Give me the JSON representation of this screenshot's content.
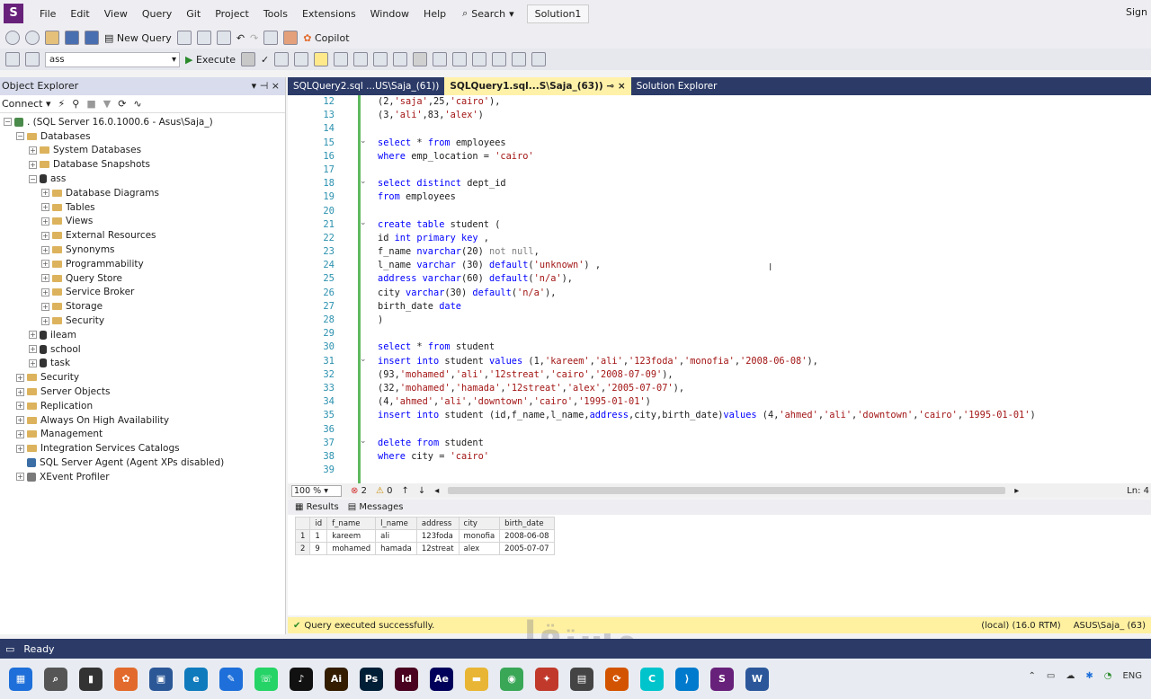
{
  "menu": {
    "items": [
      "File",
      "Edit",
      "View",
      "Query",
      "Git",
      "Project",
      "Tools",
      "Extensions",
      "Window",
      "Help"
    ],
    "search": "Search",
    "solution": "Solution1",
    "sign": "Sign"
  },
  "toolbar1": {
    "new_query": "New Query",
    "copilot": "Copilot"
  },
  "toolbar2": {
    "database": "ass",
    "execute": "Execute"
  },
  "object_explorer": {
    "title": "Object Explorer",
    "connect": "Connect",
    "nodes": [
      {
        "label": ". (SQL Server 16.0.1000.6 - Asus\\Saja_)",
        "level": 0,
        "kind": "server",
        "exp": "-"
      },
      {
        "label": "Databases",
        "level": 1,
        "kind": "folder",
        "exp": "-"
      },
      {
        "label": "System Databases",
        "level": 2,
        "kind": "folder",
        "exp": "+"
      },
      {
        "label": "Database Snapshots",
        "level": 2,
        "kind": "folder",
        "exp": "+"
      },
      {
        "label": "ass",
        "level": 2,
        "kind": "db",
        "exp": "-"
      },
      {
        "label": "Database Diagrams",
        "level": 3,
        "kind": "folder",
        "exp": "+"
      },
      {
        "label": "Tables",
        "level": 3,
        "kind": "folder",
        "exp": "+"
      },
      {
        "label": "Views",
        "level": 3,
        "kind": "folder",
        "exp": "+"
      },
      {
        "label": "External Resources",
        "level": 3,
        "kind": "folder",
        "exp": "+"
      },
      {
        "label": "Synonyms",
        "level": 3,
        "kind": "folder",
        "exp": "+"
      },
      {
        "label": "Programmability",
        "level": 3,
        "kind": "folder",
        "exp": "+"
      },
      {
        "label": "Query Store",
        "level": 3,
        "kind": "folder",
        "exp": "+"
      },
      {
        "label": "Service Broker",
        "level": 3,
        "kind": "folder",
        "exp": "+"
      },
      {
        "label": "Storage",
        "level": 3,
        "kind": "folder",
        "exp": "+"
      },
      {
        "label": "Security",
        "level": 3,
        "kind": "folder",
        "exp": "+"
      },
      {
        "label": "ileam",
        "level": 2,
        "kind": "db",
        "exp": "+"
      },
      {
        "label": "school",
        "level": 2,
        "kind": "db",
        "exp": "+"
      },
      {
        "label": "task",
        "level": 2,
        "kind": "db",
        "exp": "+"
      },
      {
        "label": "Security",
        "level": 1,
        "kind": "folder",
        "exp": "+"
      },
      {
        "label": "Server Objects",
        "level": 1,
        "kind": "folder",
        "exp": "+"
      },
      {
        "label": "Replication",
        "level": 1,
        "kind": "folder",
        "exp": "+"
      },
      {
        "label": "Always On High Availability",
        "level": 1,
        "kind": "folder",
        "exp": "+"
      },
      {
        "label": "Management",
        "level": 1,
        "kind": "folder",
        "exp": "+"
      },
      {
        "label": "Integration Services Catalogs",
        "level": 1,
        "kind": "folder",
        "exp": "+"
      },
      {
        "label": "SQL Server Agent (Agent XPs disabled)",
        "level": 1,
        "kind": "agent",
        "exp": ""
      },
      {
        "label": "XEvent Profiler",
        "level": 1,
        "kind": "xevent",
        "exp": "+"
      }
    ]
  },
  "tabs": [
    {
      "label": "SQLQuery2.sql ...US\\Saja_(61))",
      "active": false
    },
    {
      "label": "SQLQuery1.sql...S\\Saja_(63))",
      "active": true
    },
    {
      "label": "Solution Explorer",
      "active": false
    }
  ],
  "editor": {
    "lines": [
      {
        "n": "12",
        "fold": false,
        "tokens": [
          [
            "",
            "("
          ],
          [
            "num",
            "2"
          ],
          [
            "",
            ","
          ],
          [
            "str",
            "'saja'"
          ],
          [
            "",
            ",25,"
          ],
          [
            "str",
            "'cairo'"
          ],
          [
            "",
            "),"
          ]
        ]
      },
      {
        "n": "13",
        "fold": false,
        "tokens": [
          [
            "",
            "(3,"
          ],
          [
            "str",
            "'ali'"
          ],
          [
            "",
            ",83,"
          ],
          [
            "str",
            "'alex'"
          ],
          [
            "",
            ")"
          ]
        ]
      },
      {
        "n": "14",
        "fold": false,
        "tokens": []
      },
      {
        "n": "15",
        "fold": true,
        "tokens": [
          [
            "kw",
            "select"
          ],
          [
            "",
            " * "
          ],
          [
            "kw",
            "from"
          ],
          [
            "",
            " employees"
          ]
        ]
      },
      {
        "n": "16",
        "fold": false,
        "tokens": [
          [
            "kw",
            "where"
          ],
          [
            "",
            " emp_location = "
          ],
          [
            "str",
            "'cairo'"
          ]
        ]
      },
      {
        "n": "17",
        "fold": false,
        "tokens": []
      },
      {
        "n": "18",
        "fold": true,
        "tokens": [
          [
            "kw",
            "select distinct"
          ],
          [
            "",
            " dept_id"
          ]
        ]
      },
      {
        "n": "19",
        "fold": false,
        "tokens": [
          [
            "kw",
            "from"
          ],
          [
            "",
            " employees"
          ]
        ]
      },
      {
        "n": "20",
        "fold": false,
        "tokens": []
      },
      {
        "n": "21",
        "fold": true,
        "tokens": [
          [
            "kw",
            "create table"
          ],
          [
            "",
            " student ("
          ]
        ]
      },
      {
        "n": "22",
        "fold": false,
        "tokens": [
          [
            "",
            "id "
          ],
          [
            "kw",
            "int primary key"
          ],
          [
            "",
            " ,"
          ]
        ]
      },
      {
        "n": "23",
        "fold": false,
        "tokens": [
          [
            "",
            "f_name "
          ],
          [
            "kw",
            "nvarchar"
          ],
          [
            "",
            "(20) "
          ],
          [
            "gr",
            "not null"
          ],
          [
            "",
            ","
          ]
        ]
      },
      {
        "n": "24",
        "fold": false,
        "tokens": [
          [
            "",
            "l_name "
          ],
          [
            "kw",
            "varchar"
          ],
          [
            "",
            " (30) "
          ],
          [
            "kw",
            "default"
          ],
          [
            "",
            "("
          ],
          [
            "str",
            "'unknown'"
          ],
          [
            "",
            ") ,"
          ]
        ]
      },
      {
        "n": "25",
        "fold": false,
        "tokens": [
          [
            "kw",
            "address varchar"
          ],
          [
            "",
            "(60) "
          ],
          [
            "kw",
            "default"
          ],
          [
            "",
            "("
          ],
          [
            "str",
            "'n/a'"
          ],
          [
            "",
            "),"
          ]
        ]
      },
      {
        "n": "26",
        "fold": false,
        "tokens": [
          [
            "",
            "city "
          ],
          [
            "kw",
            "varchar"
          ],
          [
            "",
            "(30) "
          ],
          [
            "kw",
            "default"
          ],
          [
            "",
            "("
          ],
          [
            "str",
            "'n/a'"
          ],
          [
            "",
            "),"
          ]
        ]
      },
      {
        "n": "27",
        "fold": false,
        "tokens": [
          [
            "",
            "birth_date "
          ],
          [
            "kw",
            "date"
          ]
        ]
      },
      {
        "n": "28",
        "fold": false,
        "tokens": [
          [
            "",
            ")"
          ]
        ]
      },
      {
        "n": "29",
        "fold": false,
        "tokens": []
      },
      {
        "n": "30",
        "fold": false,
        "tokens": [
          [
            "kw",
            "select"
          ],
          [
            "",
            " * "
          ],
          [
            "kw",
            "from"
          ],
          [
            "",
            " student"
          ]
        ]
      },
      {
        "n": "31",
        "fold": true,
        "tokens": [
          [
            "kw",
            "insert into"
          ],
          [
            "",
            " student "
          ],
          [
            "kw",
            "values"
          ],
          [
            "",
            " (1,"
          ],
          [
            "str",
            "'kareem'"
          ],
          [
            "",
            ","
          ],
          [
            "str",
            "'ali'"
          ],
          [
            "",
            ","
          ],
          [
            "str",
            "'123foda'"
          ],
          [
            "",
            ","
          ],
          [
            "str",
            "'monofia'"
          ],
          [
            "",
            ","
          ],
          [
            "str",
            "'2008-06-08'"
          ],
          [
            "",
            "),"
          ]
        ]
      },
      {
        "n": "32",
        "fold": false,
        "tokens": [
          [
            "",
            "(93,"
          ],
          [
            "str",
            "'mohamed'"
          ],
          [
            "",
            ","
          ],
          [
            "str",
            "'ali'"
          ],
          [
            "",
            ","
          ],
          [
            "str",
            "'12streat'"
          ],
          [
            "",
            ","
          ],
          [
            "str",
            "'cairo'"
          ],
          [
            "",
            ","
          ],
          [
            "str",
            "'2008-07-09'"
          ],
          [
            "",
            "),"
          ]
        ]
      },
      {
        "n": "33",
        "fold": false,
        "tokens": [
          [
            "",
            "(32,"
          ],
          [
            "str",
            "'mohamed'"
          ],
          [
            "",
            ","
          ],
          [
            "str",
            "'hamada'"
          ],
          [
            "",
            ","
          ],
          [
            "str",
            "'12streat'"
          ],
          [
            "",
            ","
          ],
          [
            "str",
            "'alex'"
          ],
          [
            "",
            ","
          ],
          [
            "str",
            "'2005-07-07'"
          ],
          [
            "",
            "),"
          ]
        ]
      },
      {
        "n": "34",
        "fold": false,
        "tokens": [
          [
            "",
            "(4,"
          ],
          [
            "str",
            "'ahmed'"
          ],
          [
            "",
            ","
          ],
          [
            "str",
            "'ali'"
          ],
          [
            "",
            ","
          ],
          [
            "str",
            "'downtown'"
          ],
          [
            "",
            ","
          ],
          [
            "str",
            "'cairo'"
          ],
          [
            "",
            ","
          ],
          [
            "str",
            "'1995-01-01'"
          ],
          [
            "",
            ")"
          ]
        ]
      },
      {
        "n": "35",
        "fold": false,
        "tokens": [
          [
            "kw",
            "insert into"
          ],
          [
            "",
            " student (id,f_name,l_name,"
          ],
          [
            "kw",
            "address"
          ],
          [
            "",
            ",city,birth_date)"
          ],
          [
            "kw",
            "values"
          ],
          [
            "",
            " (4,"
          ],
          [
            "str",
            "'ahmed'"
          ],
          [
            "",
            ","
          ],
          [
            "str",
            "'ali'"
          ],
          [
            "",
            ","
          ],
          [
            "str",
            "'downtown'"
          ],
          [
            "",
            ","
          ],
          [
            "str",
            "'cairo'"
          ],
          [
            "",
            ","
          ],
          [
            "str",
            "'1995-01-01'"
          ],
          [
            "",
            ")"
          ]
        ]
      },
      {
        "n": "36",
        "fold": false,
        "tokens": []
      },
      {
        "n": "37",
        "fold": true,
        "tokens": [
          [
            "kw",
            "delete from"
          ],
          [
            "",
            " student"
          ]
        ]
      },
      {
        "n": "38",
        "fold": false,
        "tokens": [
          [
            "kw",
            "where"
          ],
          [
            "",
            " city = "
          ],
          [
            "str",
            "'cairo'"
          ]
        ]
      },
      {
        "n": "39",
        "fold": false,
        "tokens": []
      }
    ]
  },
  "editor_status": {
    "zoom": "100 %",
    "errors": "2",
    "warnings": "0",
    "ln": "Ln: 4"
  },
  "result_tabs": {
    "results": "Results",
    "messages": "Messages"
  },
  "results": {
    "columns": [
      "id",
      "f_name",
      "l_name",
      "address",
      "city",
      "birth_date"
    ],
    "rows": [
      {
        "rn": "1",
        "cells": [
          "1",
          "kareem",
          "ali",
          "123foda",
          "monofia",
          "2008-06-08"
        ]
      },
      {
        "rn": "2",
        "cells": [
          "9",
          "mohamed",
          "hamada",
          "12streat",
          "alex",
          "2005-07-07"
        ]
      }
    ]
  },
  "query_status": {
    "message": "Query executed successfully.",
    "server": "(local) (16.0 RTM)",
    "user": "ASUS\\Saja_ (63)"
  },
  "status_bar": {
    "ready": "Ready"
  },
  "taskbar": {
    "icons": [
      {
        "name": "windows-start-icon",
        "glyph": "▦",
        "color": "#1e6fd9"
      },
      {
        "name": "search-icon",
        "glyph": "⌕",
        "color": "#555"
      },
      {
        "name": "file-explorer-dark-icon",
        "glyph": "▮",
        "color": "#333"
      },
      {
        "name": "copilot-icon",
        "glyph": "✿",
        "color": "#e26a2c"
      },
      {
        "name": "store-icon",
        "glyph": "▣",
        "color": "#2b5797"
      },
      {
        "name": "edge-icon",
        "glyph": "e",
        "color": "#0f7bbd"
      },
      {
        "name": "whiteboard-icon",
        "glyph": "✎",
        "color": "#1e6fd9"
      },
      {
        "name": "whatsapp-icon",
        "glyph": "☏",
        "color": "#25d366"
      },
      {
        "name": "tiktok-icon",
        "glyph": "♪",
        "color": "#111"
      },
      {
        "name": "illustrator-icon",
        "glyph": "Ai",
        "color": "#331c00"
      },
      {
        "name": "photoshop-icon",
        "glyph": "Ps",
        "color": "#001e36"
      },
      {
        "name": "indesign-icon",
        "glyph": "Id",
        "color": "#49021f"
      },
      {
        "name": "after-effects-icon",
        "glyph": "Ae",
        "color": "#00005b"
      },
      {
        "name": "folder-icon",
        "glyph": "▬",
        "color": "#e8b634"
      },
      {
        "name": "chrome-icon",
        "glyph": "◉",
        "color": "#3aa757"
      },
      {
        "name": "app-icon",
        "glyph": "✦",
        "color": "#c0392b"
      },
      {
        "name": "app-icon-2",
        "glyph": "▤",
        "color": "#444"
      },
      {
        "name": "sync-icon",
        "glyph": "⟳",
        "color": "#d35400"
      },
      {
        "name": "canva-icon",
        "glyph": "C",
        "color": "#00c4cc"
      },
      {
        "name": "vscode-icon",
        "glyph": "⟩",
        "color": "#007acc"
      },
      {
        "name": "ssms-icon",
        "glyph": "S",
        "color": "#68217a"
      },
      {
        "name": "word-icon",
        "glyph": "W",
        "color": "#2b579a"
      }
    ],
    "tray": {
      "lang": "ENG"
    }
  },
  "watermark": "مستقل"
}
